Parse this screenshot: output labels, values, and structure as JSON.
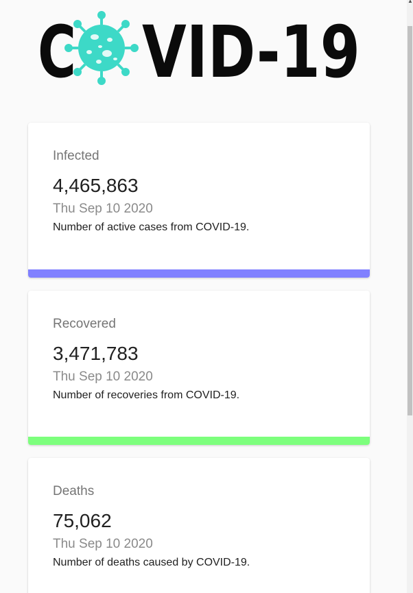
{
  "logo": {
    "text_before": "C",
    "text_after": "VID-19",
    "virus_color": "#3dd9c7",
    "text_color": "#0b0b0b"
  },
  "cards": [
    {
      "title": "Infected",
      "value": "4,465,863",
      "date": "Thu Sep 10 2020",
      "description": "Number of active cases from COVID-19.",
      "bar_color": "#8080ff"
    },
    {
      "title": "Recovered",
      "value": "3,471,783",
      "date": "Thu Sep 10 2020",
      "description": "Number of recoveries from COVID-19.",
      "bar_color": "#7dff7d"
    },
    {
      "title": "Deaths",
      "value": "75,062",
      "date": "Thu Sep 10 2020",
      "description": "Number of deaths caused by COVID-19.",
      "bar_color": "#ff7d7d"
    }
  ],
  "scrollbar": {
    "up_arrow_icon": "chevron-up-icon"
  }
}
